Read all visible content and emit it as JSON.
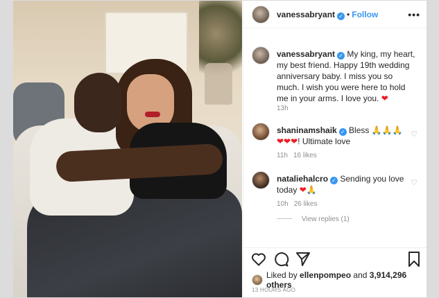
{
  "header": {
    "username": "vanessabryant",
    "follow_label": "Follow",
    "more_icon": "more-icon"
  },
  "caption": {
    "username": "vanessabryant",
    "text": "My king, my heart, my best friend. Happy 19th wedding anniversary baby. I miss you so much. I wish you were here to hold me in your arms. I love you.",
    "emoji": "❤",
    "time": "13h"
  },
  "comments": [
    {
      "username": "shaninamshaik",
      "text_a": "Bless",
      "emoji_a": "🙏🙏🙏",
      "emoji_b": "❤❤❤",
      "text_b": "! Ultimate love",
      "time": "11h",
      "likes": "16 likes"
    },
    {
      "username": "nataliehalcro",
      "text_a": "Sending you love today",
      "emoji_a": "❤🙏",
      "time": "10h",
      "likes": "26 likes"
    }
  ],
  "view_replies": "View replies (1)",
  "icons": [
    "heart-icon",
    "comment-icon",
    "share-icon",
    "bookmark-icon"
  ],
  "likes": {
    "prefix": "Liked by",
    "user": "ellenpompeo",
    "and": "and",
    "count": "3,914,296 others"
  },
  "timestamp": "13 HOURS AGO",
  "colors": {
    "link": "#3897f0",
    "heart": "#ed1c24",
    "muted": "#8e8e8e"
  }
}
